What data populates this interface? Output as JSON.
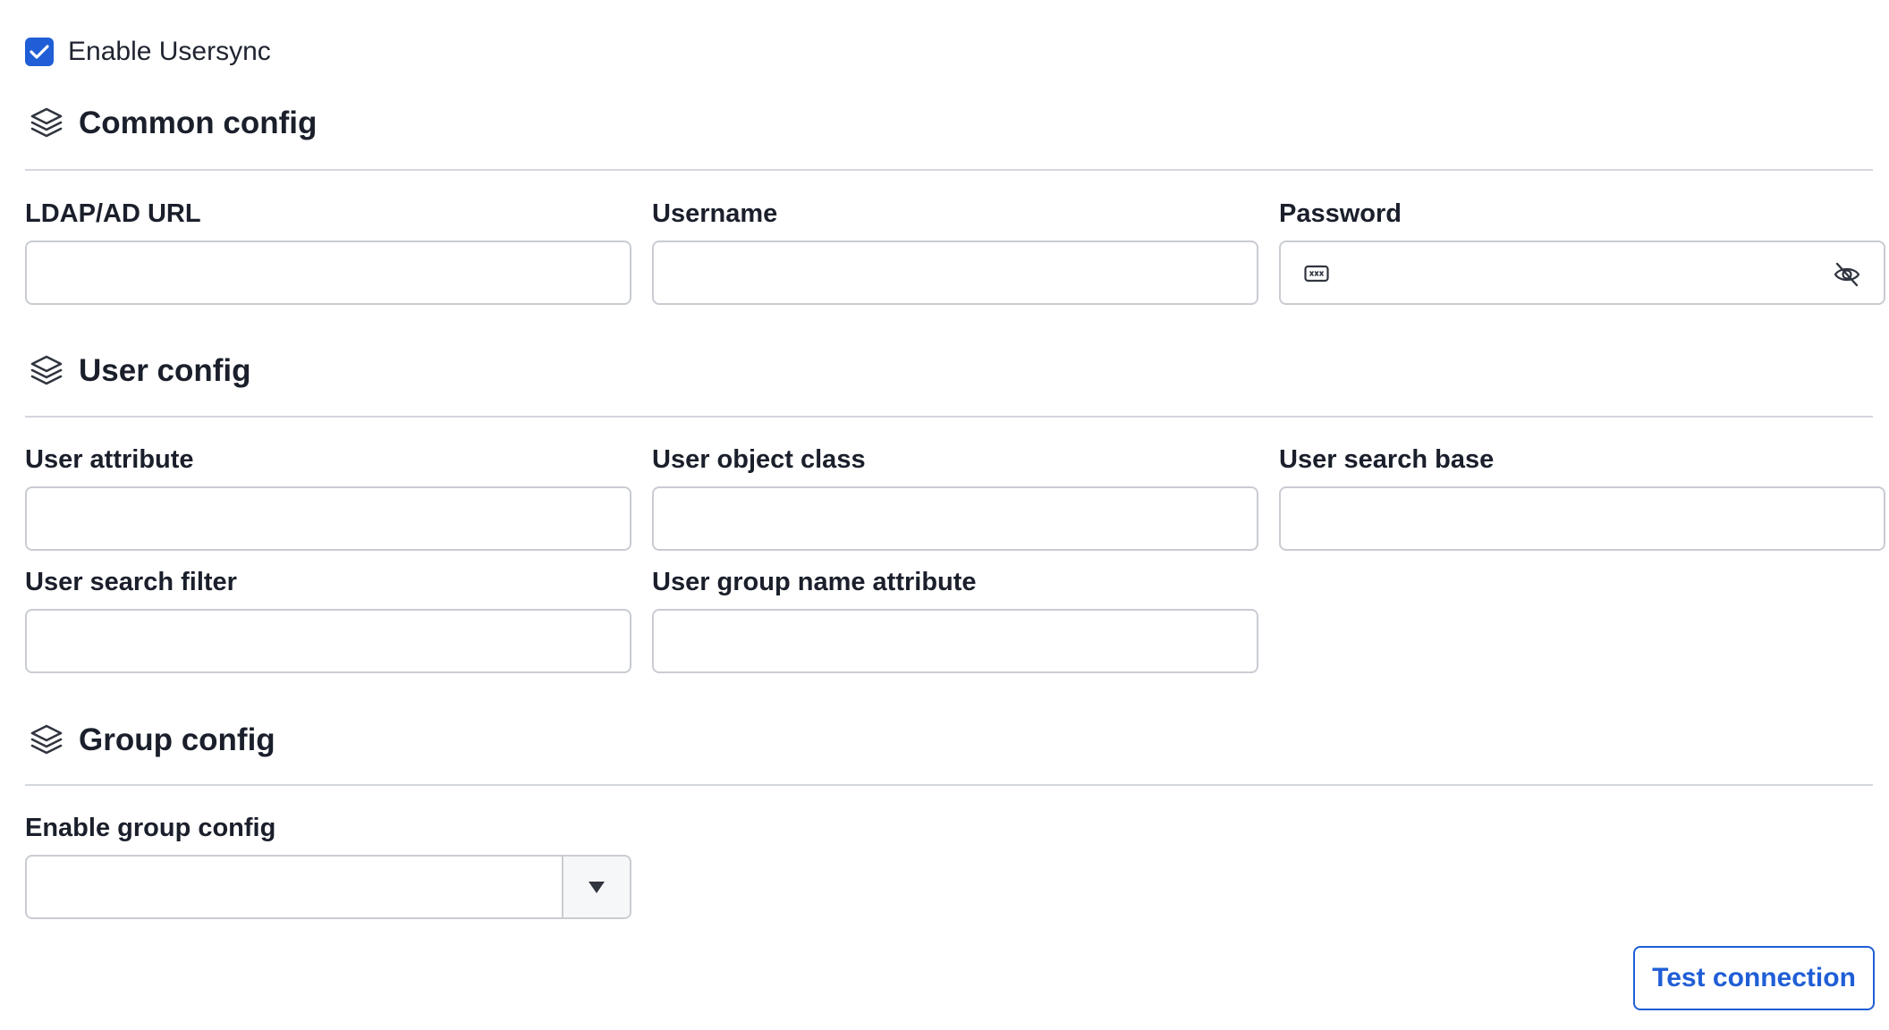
{
  "usersync": {
    "label": "Enable Usersync",
    "checked": true
  },
  "sections": {
    "common": {
      "title": "Common config",
      "icon": "layers-icon"
    },
    "user": {
      "title": "User config",
      "icon": "layers-icon"
    },
    "group": {
      "title": "Group config",
      "icon": "layers-icon"
    }
  },
  "common_fields": {
    "ldap_url": {
      "label": "LDAP/AD URL",
      "value": ""
    },
    "username": {
      "label": "Username",
      "value": ""
    },
    "password": {
      "label": "Password",
      "value": "",
      "icon": "password-dots-icon",
      "toggle_icon": "eye-off-icon"
    }
  },
  "user_fields": {
    "user_attribute": {
      "label": "User attribute",
      "value": ""
    },
    "user_object_class": {
      "label": "User object class",
      "value": ""
    },
    "user_search_base": {
      "label": "User search base",
      "value": ""
    },
    "user_search_filter": {
      "label": "User search filter",
      "value": ""
    },
    "user_group_name_attribute": {
      "label": "User group name attribute",
      "value": ""
    }
  },
  "group_fields": {
    "enable_group_config": {
      "label": "Enable group config",
      "selected": "",
      "toggle_icon": "caret-down-icon"
    }
  },
  "actions": {
    "test_connection": "Test connection"
  },
  "colors": {
    "accent": "#1f5ed6",
    "border": "#c9ccd2",
    "divider": "#d4d7dc",
    "text": "#1a1f2b"
  }
}
